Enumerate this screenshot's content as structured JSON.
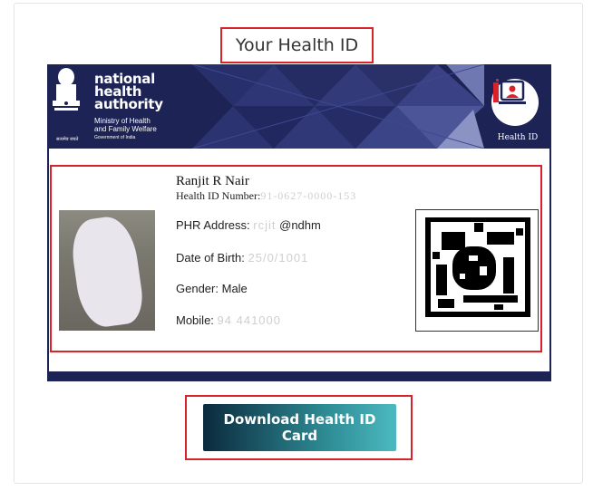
{
  "page": {
    "title": "Your Health ID"
  },
  "card": {
    "org_name_lines": [
      "national",
      "health",
      "authority"
    ],
    "ministry_lines": [
      "Ministry of Health",
      "and Family Welfare"
    ],
    "govt_text": "Government of India",
    "hindi_text": "सत्यमेव जयते",
    "badge_label": "Health ID",
    "name": "Ranjit R Nair",
    "health_id_label": "Health ID Number:",
    "health_id_value": "91-0627-0000-153",
    "phr_label": "PHR Address:",
    "phr_value_masked": "rcjit",
    "phr_suffix": "@ndhm",
    "dob_label": "Date of Birth:",
    "dob_value": "25/0/1001",
    "gender_label": "Gender:",
    "gender_value": "Male",
    "mobile_label": "Mobile:",
    "mobile_value": "94 441000"
  },
  "actions": {
    "download_label": "Download Health ID Card"
  },
  "colors": {
    "highlight_border": "#d9222a",
    "card_header_bg": "#1d2354",
    "button_gradient_start": "#0b2a3d",
    "button_gradient_end": "#4cb9c0"
  }
}
